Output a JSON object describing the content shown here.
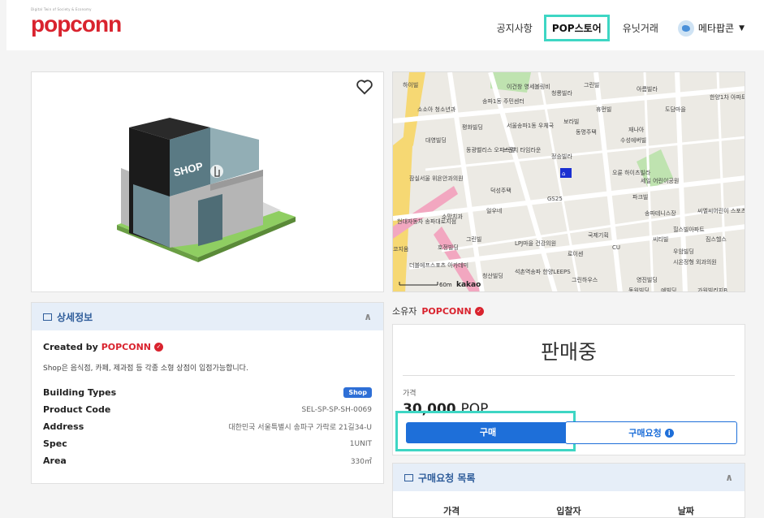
{
  "header": {
    "logo_tagline": "Digital Twin of Society & Economy",
    "logo": "popconn",
    "nav": [
      "공지사항",
      "POP스토어",
      "유닛거래"
    ],
    "active_nav": "POP스토어",
    "user": "메타팝콘"
  },
  "detail": {
    "title": "상세정보",
    "created_by_label": "Created by",
    "creator": "POPCONN",
    "description": "Shop은 음식점, 카페, 제과점 등 각종 소형 상점이 입점가능합니다.",
    "specs": [
      {
        "key": "Building Types",
        "value": "Shop"
      },
      {
        "key": "Product Code",
        "value": "SEL-SP-SP-SH-0069"
      },
      {
        "key": "Address",
        "value": "대한민국 서울특별시 송파구 가락로 21길34-U"
      },
      {
        "key": "Spec",
        "value": "1UNIT"
      },
      {
        "key": "Area",
        "value": "330㎡"
      }
    ]
  },
  "building": {
    "sign": "SHOP"
  },
  "map": {
    "attribution": "kakao",
    "scale": "60m",
    "labels": [
      "하이빌",
      "이건창 영세볼링비",
      "송파1동 주민센터",
      "소소아 청소년과",
      "평화빌딩",
      "서울송파1동 우체국",
      "대영빌딩",
      "동광벨리스 오피스텔",
      "브런치 타임라운",
      "정승빌라",
      "잠실서울 위욘안과의원",
      "덕성주택",
      "GS25",
      "현대자동차 송파대로지점",
      "소망치과",
      "일우네",
      "그린빌",
      "LPJ마을 건강의원",
      "국제기획",
      "휴먼빌",
      "보라빌",
      "동명주택",
      "재나아",
      "수성에버빌",
      "오륜 하이츠빌라",
      "파크빌",
      "송파테니스장",
      "씨티빌",
      "우암빌딩",
      "시온정형 외과의원",
      "더블에프스포츠 아카데미",
      "청산빌딩",
      "석촌역송파 한양LEEPS",
      "그린하우스",
      "영진빌딩",
      "동원빌딩",
      "예빌딩",
      "가원빌리지B",
      "코지움",
      "호정빌딩",
      "로이센",
      "CU",
      "씨엘씨어린이 스포츠크럽",
      "힐스빌아파트",
      "짐스헬스",
      "한양1차 아파트",
      "도담마을",
      "아름빌라",
      "그린빌",
      "청룡빌라",
      "세일 어린이공원"
    ]
  },
  "owner": {
    "label": "소유자",
    "name": "POPCONN"
  },
  "sale": {
    "status": "판매중",
    "price_label": "가격",
    "price_value": "30,000",
    "price_unit": "POP",
    "buy_button": "구매",
    "request_button": "구매요청"
  },
  "request_list": {
    "title": "구매요청 목록",
    "columns": [
      "가격",
      "입찰자",
      "날짜"
    ]
  },
  "colors": {
    "brand": "#d9232e",
    "primary": "#1e6fd9",
    "highlight": "#3ed6c4"
  }
}
